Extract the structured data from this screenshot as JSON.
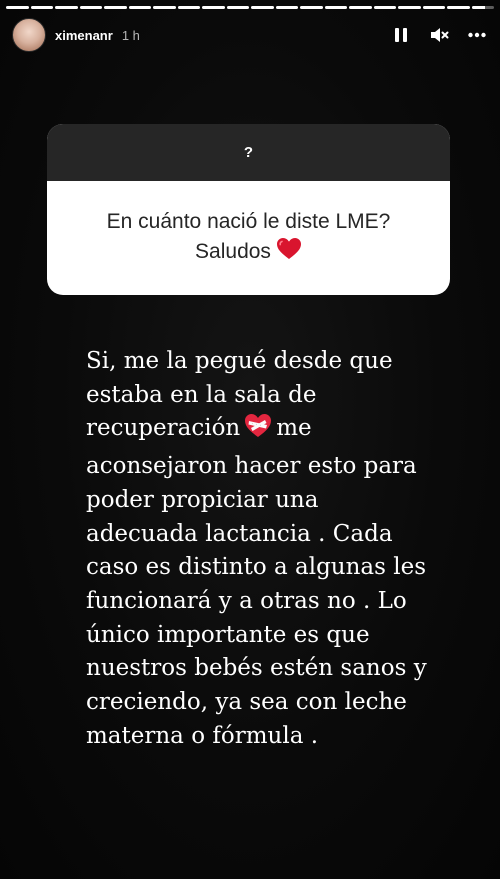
{
  "story": {
    "username": "ximenanr",
    "time": "1 h",
    "progress": [
      1,
      1,
      1,
      1,
      1,
      1,
      1,
      1,
      1,
      1,
      1,
      1,
      1,
      1,
      1,
      1,
      1,
      1,
      1,
      0.6
    ],
    "icons": {
      "pause": "pause-icon",
      "mute": "speaker-muted-icon",
      "more": "more-options-icon"
    }
  },
  "question_card": {
    "header": "?",
    "question_line1": "En cuánto nació le diste LME?",
    "question_line2": "Saludos",
    "emoji": "red-heart"
  },
  "answer": {
    "lines": [
      "Si, me la pegué desde que",
      "estaba en la sala de",
      "recuperación",
      "me",
      "aconsejaron hacer esto para",
      "poder propiciar una",
      "adecuada lactancia . Cada",
      "caso es distinto a algunas les",
      "funcionará y a otras no . Lo",
      "único importante es que",
      "nuestros bebés estén sanos y",
      "creciendo, ya sea con leche",
      "materna o fórmula ."
    ],
    "emoji": "mending-heart"
  }
}
